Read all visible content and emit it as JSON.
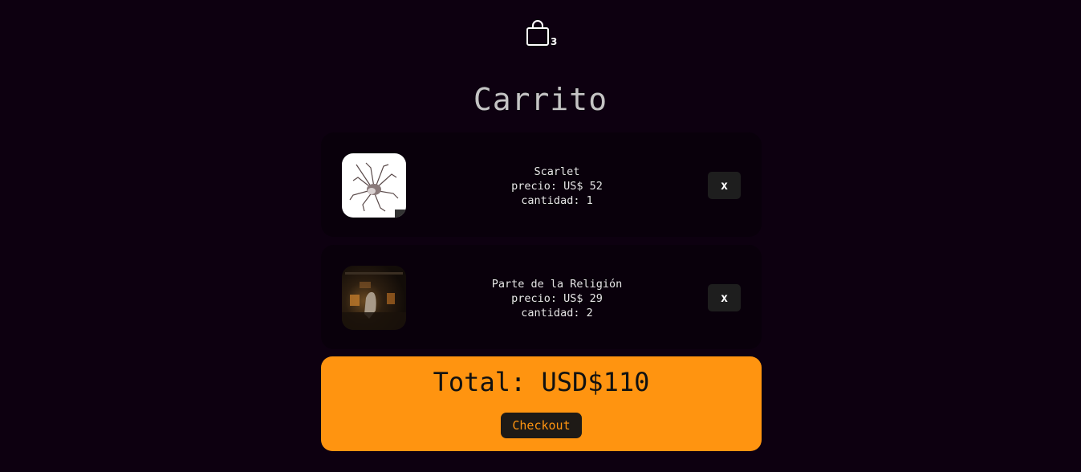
{
  "header": {
    "cart_icon": "shopping-bag-icon",
    "cart_count": "3"
  },
  "title": "Carrito",
  "items": [
    {
      "name": "Scarlet",
      "price_text": "precio: US$ 52",
      "quantity_text": "cantidad: 1",
      "remove_label": "x",
      "cover_icon": "album-cover-scarlet"
    },
    {
      "name": "Parte de la Religión",
      "price_text": "precio: US$ 29",
      "quantity_text": "cantidad: 2",
      "remove_label": "x",
      "cover_icon": "album-cover-parte-de-la-religion"
    }
  ],
  "summary": {
    "total_text": "Total: USD$110",
    "checkout_label": "Checkout"
  },
  "colors": {
    "background": "#0d0010",
    "item_card": "#09000b",
    "accent": "#ff9410",
    "button_dark": "#1e1e1e"
  }
}
